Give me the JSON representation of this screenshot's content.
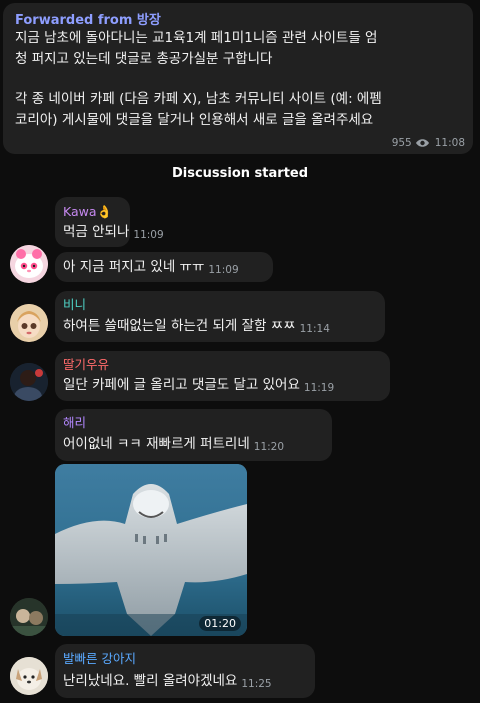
{
  "forwarded": {
    "header": "Forwarded from 방장",
    "line1": "지금 남초에 돌아다니는 교1육1계 페1미1니즘 관련 사이트들 엄",
    "line2": "청 퍼지고 있는데 댓글로 총공가실분 구합니다",
    "line3": "각 종 네이버 카페 (다음 카페 X), 남초 커뮤니티 사이트 (예: 에펨",
    "line4": "코리아) 게시물에 댓글을 달거나 인용해서 새로 글을 올려주세요",
    "views": "955",
    "time": "11:08"
  },
  "notice": "Discussion started",
  "messages": [
    {
      "sender": "Kawa👌",
      "sender_color": "#c689f0",
      "text": "먹금 안되나",
      "time": "11:09"
    },
    {
      "sender": "",
      "text": "아 지금 퍼지고 있네 ㅠㅠ",
      "time": "11:09"
    },
    {
      "sender": "비니",
      "sender_color": "#4fd1c5",
      "text": "하여튼 쓸때없는일 하는건 되게 잘함 ㅉㅉ",
      "time": "11:14"
    },
    {
      "sender": "딸기우유",
      "sender_color": "#ff6b6b",
      "text": "일단 카페에 글 올리고 댓글도 달고 있어요",
      "time": "11:19"
    },
    {
      "sender": "해리",
      "sender_color": "#b388ff",
      "text": "어이없네 ㅋㅋ 재빠르게 퍼트리네",
      "time": "11:20"
    },
    {
      "sender": "",
      "text": "",
      "time": "01:20"
    },
    {
      "sender": "발빠른 강아지",
      "sender_color": "#5aa9ff",
      "text": "난리났네요. 빨리 올려야겠네요",
      "time": "11:25"
    }
  ]
}
